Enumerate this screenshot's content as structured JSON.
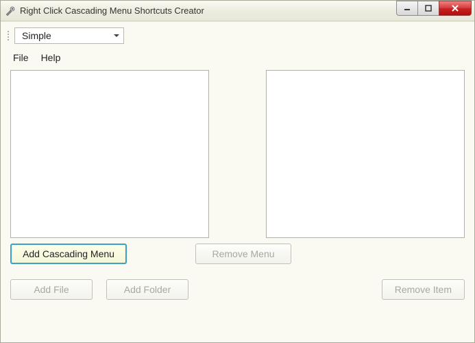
{
  "window": {
    "title": "Right Click Cascading Menu Shortcuts Creator"
  },
  "toolbar": {
    "dropdown_value": "Simple"
  },
  "menubar": {
    "file": "File",
    "help": "Help"
  },
  "buttons": {
    "add_cascading_menu": "Add Cascading Menu",
    "remove_menu": "Remove Menu",
    "add_file": "Add File",
    "add_folder": "Add Folder",
    "remove_item": "Remove Item"
  }
}
